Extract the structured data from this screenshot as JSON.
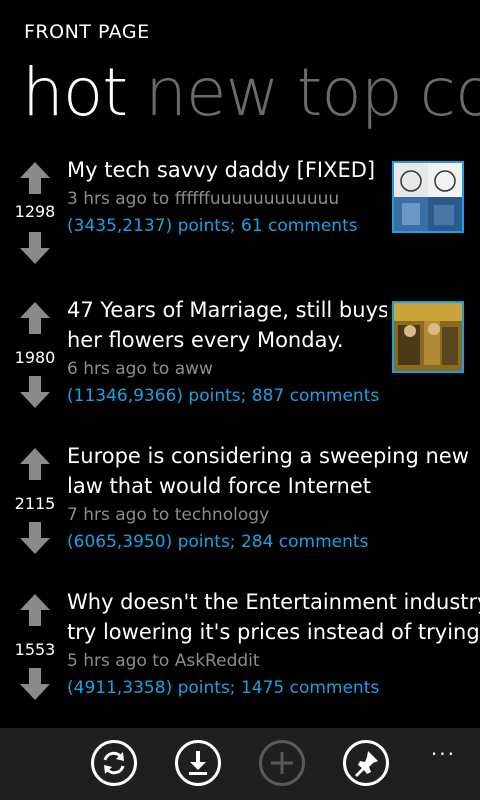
{
  "app": {
    "title": "FRONT PAGE"
  },
  "pivot": {
    "tabs": [
      "hot",
      "new",
      "top",
      "co"
    ]
  },
  "posts": [
    {
      "score": "1298",
      "title_lines": [
        "My tech savvy daddy [FIXED]"
      ],
      "meta": "3 hrs ago to ffffffuuuuuuuuuuuu",
      "points": "(3435,2137) points; 61 comments"
    },
    {
      "score": "1980",
      "title_lines": [
        "47 Years of Marriage, still buys",
        "her flowers every Monday."
      ],
      "meta": "6 hrs ago to aww",
      "points": "(11346,9366) points; 887 comments"
    },
    {
      "score": "2115",
      "title_lines": [
        "Europe is considering a sweeping new",
        "law that would force Internet"
      ],
      "meta": "7 hrs ago to technology",
      "points": "(6065,3950) points; 284 comments"
    },
    {
      "score": "1553",
      "title_lines": [
        "Why doesn't the Entertainment industry",
        "try lowering it's prices instead of trying"
      ],
      "meta": "5 hrs ago to AskReddit",
      "points": "(4911,3358) points; 1475 comments"
    }
  ],
  "appbar": {
    "buttons": [
      "refresh-icon",
      "download-icon",
      "add-icon",
      "pin-icon"
    ],
    "more": "..."
  },
  "colors": {
    "accent": "#1ba1e2",
    "meta": "#8c8c8c",
    "inactive_tab": "#6b6b6b",
    "appbar": "#1f1f1f"
  }
}
